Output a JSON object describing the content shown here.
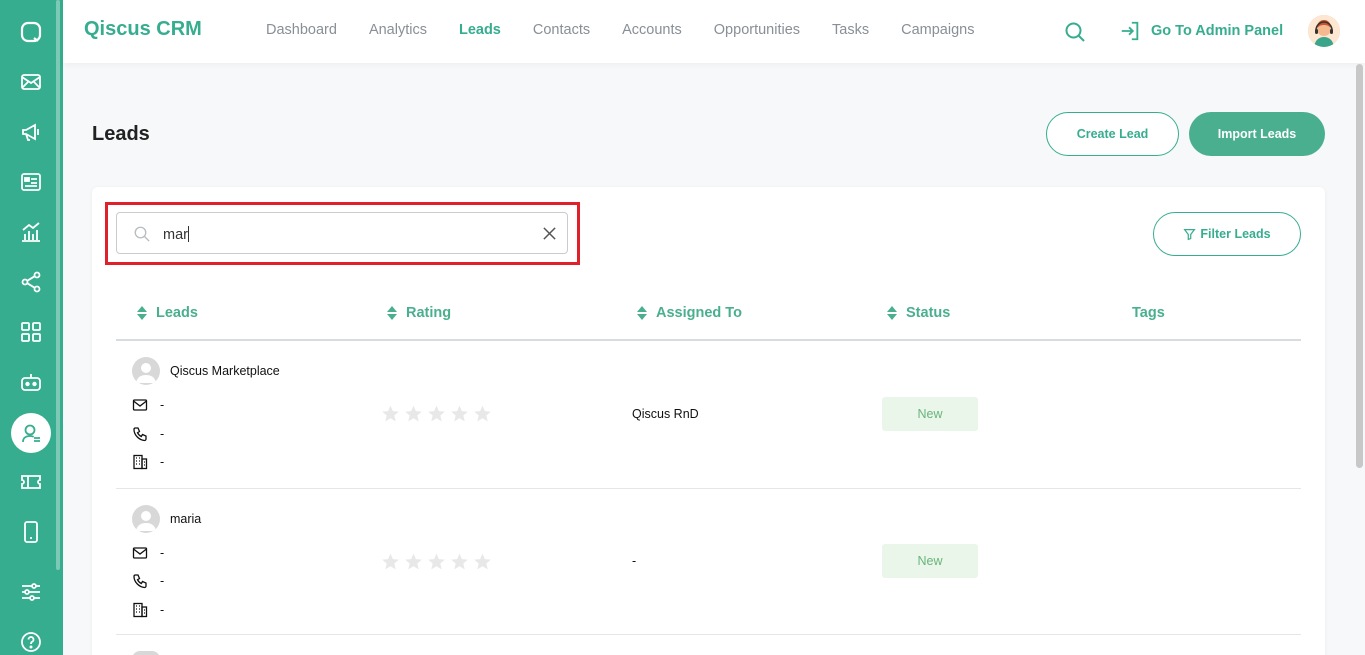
{
  "app": {
    "brand": "Qiscus CRM"
  },
  "nav": {
    "items": [
      {
        "label": "Dashboard",
        "active": false
      },
      {
        "label": "Analytics",
        "active": false
      },
      {
        "label": "Leads",
        "active": true
      },
      {
        "label": "Contacts",
        "active": false
      },
      {
        "label": "Accounts",
        "active": false
      },
      {
        "label": "Opportunities",
        "active": false
      },
      {
        "label": "Tasks",
        "active": false
      },
      {
        "label": "Campaigns",
        "active": false
      }
    ],
    "admin_label": "Go To Admin Panel"
  },
  "sidebar": {
    "icons": [
      "chat-icon",
      "mail-icon",
      "megaphone-icon",
      "contact-card-icon",
      "analytics-icon",
      "share-icon",
      "apps-icon",
      "bot-icon",
      "leads-icon",
      "ticket-icon",
      "mobile-icon",
      "settings-sliders-icon",
      "help-icon"
    ]
  },
  "page": {
    "title": "Leads",
    "create_label": "Create Lead",
    "import_label": "Import Leads",
    "filter_label": "Filter Leads"
  },
  "search": {
    "value": "mar"
  },
  "table": {
    "columns": [
      "Leads",
      "Rating",
      "Assigned To",
      "Status",
      "Tags"
    ],
    "rows": [
      {
        "name": "Qiscus Marketplace",
        "email": "-",
        "phone": "-",
        "company": "-",
        "rating": 0,
        "assigned_to": "Qiscus RnD",
        "status": "New",
        "tags": ""
      },
      {
        "name": "maria",
        "email": "-",
        "phone": "-",
        "company": "-",
        "rating": 0,
        "assigned_to": "-",
        "status": "New",
        "tags": ""
      }
    ]
  },
  "colors": {
    "accent": "#36ad8f",
    "highlight": "#e0202a",
    "status_bg": "#e9f6e9"
  }
}
